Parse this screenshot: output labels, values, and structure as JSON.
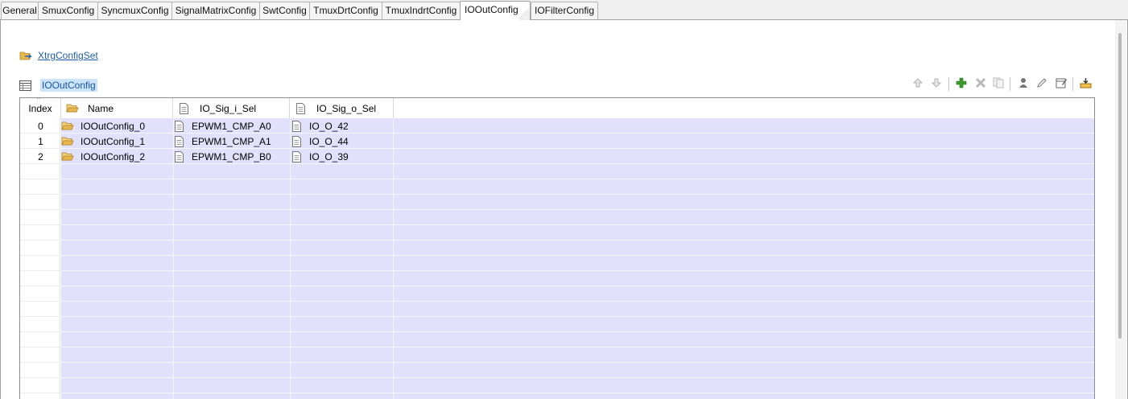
{
  "tabs": [
    {
      "label": "General",
      "active": false
    },
    {
      "label": "SmuxConfig",
      "active": false
    },
    {
      "label": "SyncmuxConfig",
      "active": false
    },
    {
      "label": "SignalMatrixConfig",
      "active": false
    },
    {
      "label": "SwtConfig",
      "active": false
    },
    {
      "label": "TmuxDrtConfig",
      "active": false
    },
    {
      "label": "TmuxIndrtConfig",
      "active": false
    },
    {
      "label": "IOOutConfig",
      "active": true
    },
    {
      "label": "IOFilterConfig",
      "active": false
    }
  ],
  "parent_link": {
    "label": "XtrgConfigSet",
    "icon": "folder-link-icon"
  },
  "section": {
    "title": "IOOutConfig",
    "icon": "table-icon"
  },
  "toolbar": [
    {
      "name": "move-up-button",
      "icon": "arrow-up-icon",
      "enabled": false
    },
    {
      "name": "move-down-button",
      "icon": "arrow-down-icon",
      "enabled": false
    },
    {
      "name": "add-button",
      "icon": "plus-icon",
      "enabled": true
    },
    {
      "name": "delete-button",
      "icon": "delete-x-icon",
      "enabled": false
    },
    {
      "name": "copy-button",
      "icon": "copy-icon",
      "enabled": false
    },
    {
      "name": "user-button",
      "icon": "user-icon",
      "enabled": true
    },
    {
      "name": "edit-button",
      "icon": "pencil-icon",
      "enabled": true
    },
    {
      "name": "edit-table-button",
      "icon": "edit-table-icon",
      "enabled": true
    },
    {
      "name": "import-button",
      "icon": "import-icon",
      "enabled": true
    }
  ],
  "table": {
    "columns": [
      {
        "label": "Index",
        "icon": ""
      },
      {
        "label": "Name",
        "icon": "folder-open-icon"
      },
      {
        "label": "IO_Sig_i_Sel",
        "icon": "document-icon"
      },
      {
        "label": "IO_Sig_o_Sel",
        "icon": "document-icon"
      }
    ],
    "sort_indicator": "^",
    "rows": [
      {
        "index": "0",
        "name": "IOOutConfig_0",
        "sig_i": "EPWM1_CMP_A0",
        "sig_o": "IO_O_42"
      },
      {
        "index": "1",
        "name": "IOOutConfig_1",
        "sig_i": "EPWM1_CMP_A1",
        "sig_o": "IO_O_44"
      },
      {
        "index": "2",
        "name": "IOOutConfig_2",
        "sig_i": "EPWM1_CMP_B0",
        "sig_o": "IO_O_39"
      }
    ]
  },
  "colors": {
    "row_fill": "#e2e1fb",
    "selection": "#cce4f7",
    "link": "#1f5ea8",
    "add_icon": "#3a9a2a",
    "folder_icon": "#e8b84c"
  }
}
